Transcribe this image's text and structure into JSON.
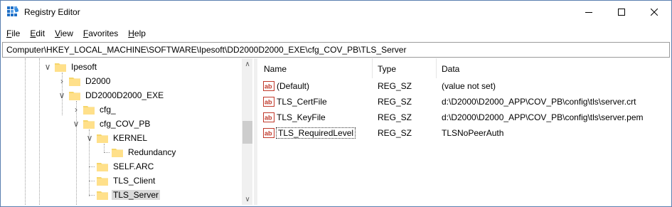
{
  "window": {
    "title": "Registry Editor"
  },
  "menu": [
    {
      "key": "F",
      "rest": "ile"
    },
    {
      "key": "E",
      "rest": "dit"
    },
    {
      "key": "V",
      "rest": "iew"
    },
    {
      "key": "F",
      "rest": "avorites"
    },
    {
      "key": "H",
      "rest": "elp"
    }
  ],
  "address": "Computer\\HKEY_LOCAL_MACHINE\\SOFTWARE\\Ipesoft\\DD2000D2000_EXE\\cfg_COV_PB\\TLS_Server",
  "tree": [
    {
      "label": "Ipesoft",
      "expander": "expanded"
    },
    {
      "label": "D2000",
      "expander": "collapsed"
    },
    {
      "label": "DD2000D2000_EXE",
      "expander": "expanded"
    },
    {
      "label": "cfg_",
      "expander": "collapsed"
    },
    {
      "label": "cfg_COV_PB",
      "expander": "expanded"
    },
    {
      "label": "KERNEL",
      "expander": "expanded"
    },
    {
      "label": "Redundancy",
      "expander": "none"
    },
    {
      "label": "SELF.ARC",
      "expander": "none"
    },
    {
      "label": "TLS_Client",
      "expander": "none"
    },
    {
      "label": "TLS_Server",
      "expander": "none",
      "selected": true
    }
  ],
  "list": {
    "columns": {
      "name": "Name",
      "type": "Type",
      "data": "Data"
    },
    "rows": [
      {
        "name": "(Default)",
        "type": "REG_SZ",
        "data": "(value not set)"
      },
      {
        "name": "TLS_CertFile",
        "type": "REG_SZ",
        "data": "d:\\D2000\\D2000_APP\\COV_PB\\config\\tls\\server.crt"
      },
      {
        "name": "TLS_KeyFile",
        "type": "REG_SZ",
        "data": "d:\\D2000\\D2000_APP\\COV_PB\\config\\tls\\server.pem"
      },
      {
        "name": "TLS_RequiredLevel",
        "type": "REG_SZ",
        "data": "TLSNoPeerAuth",
        "focused": true
      }
    ]
  }
}
